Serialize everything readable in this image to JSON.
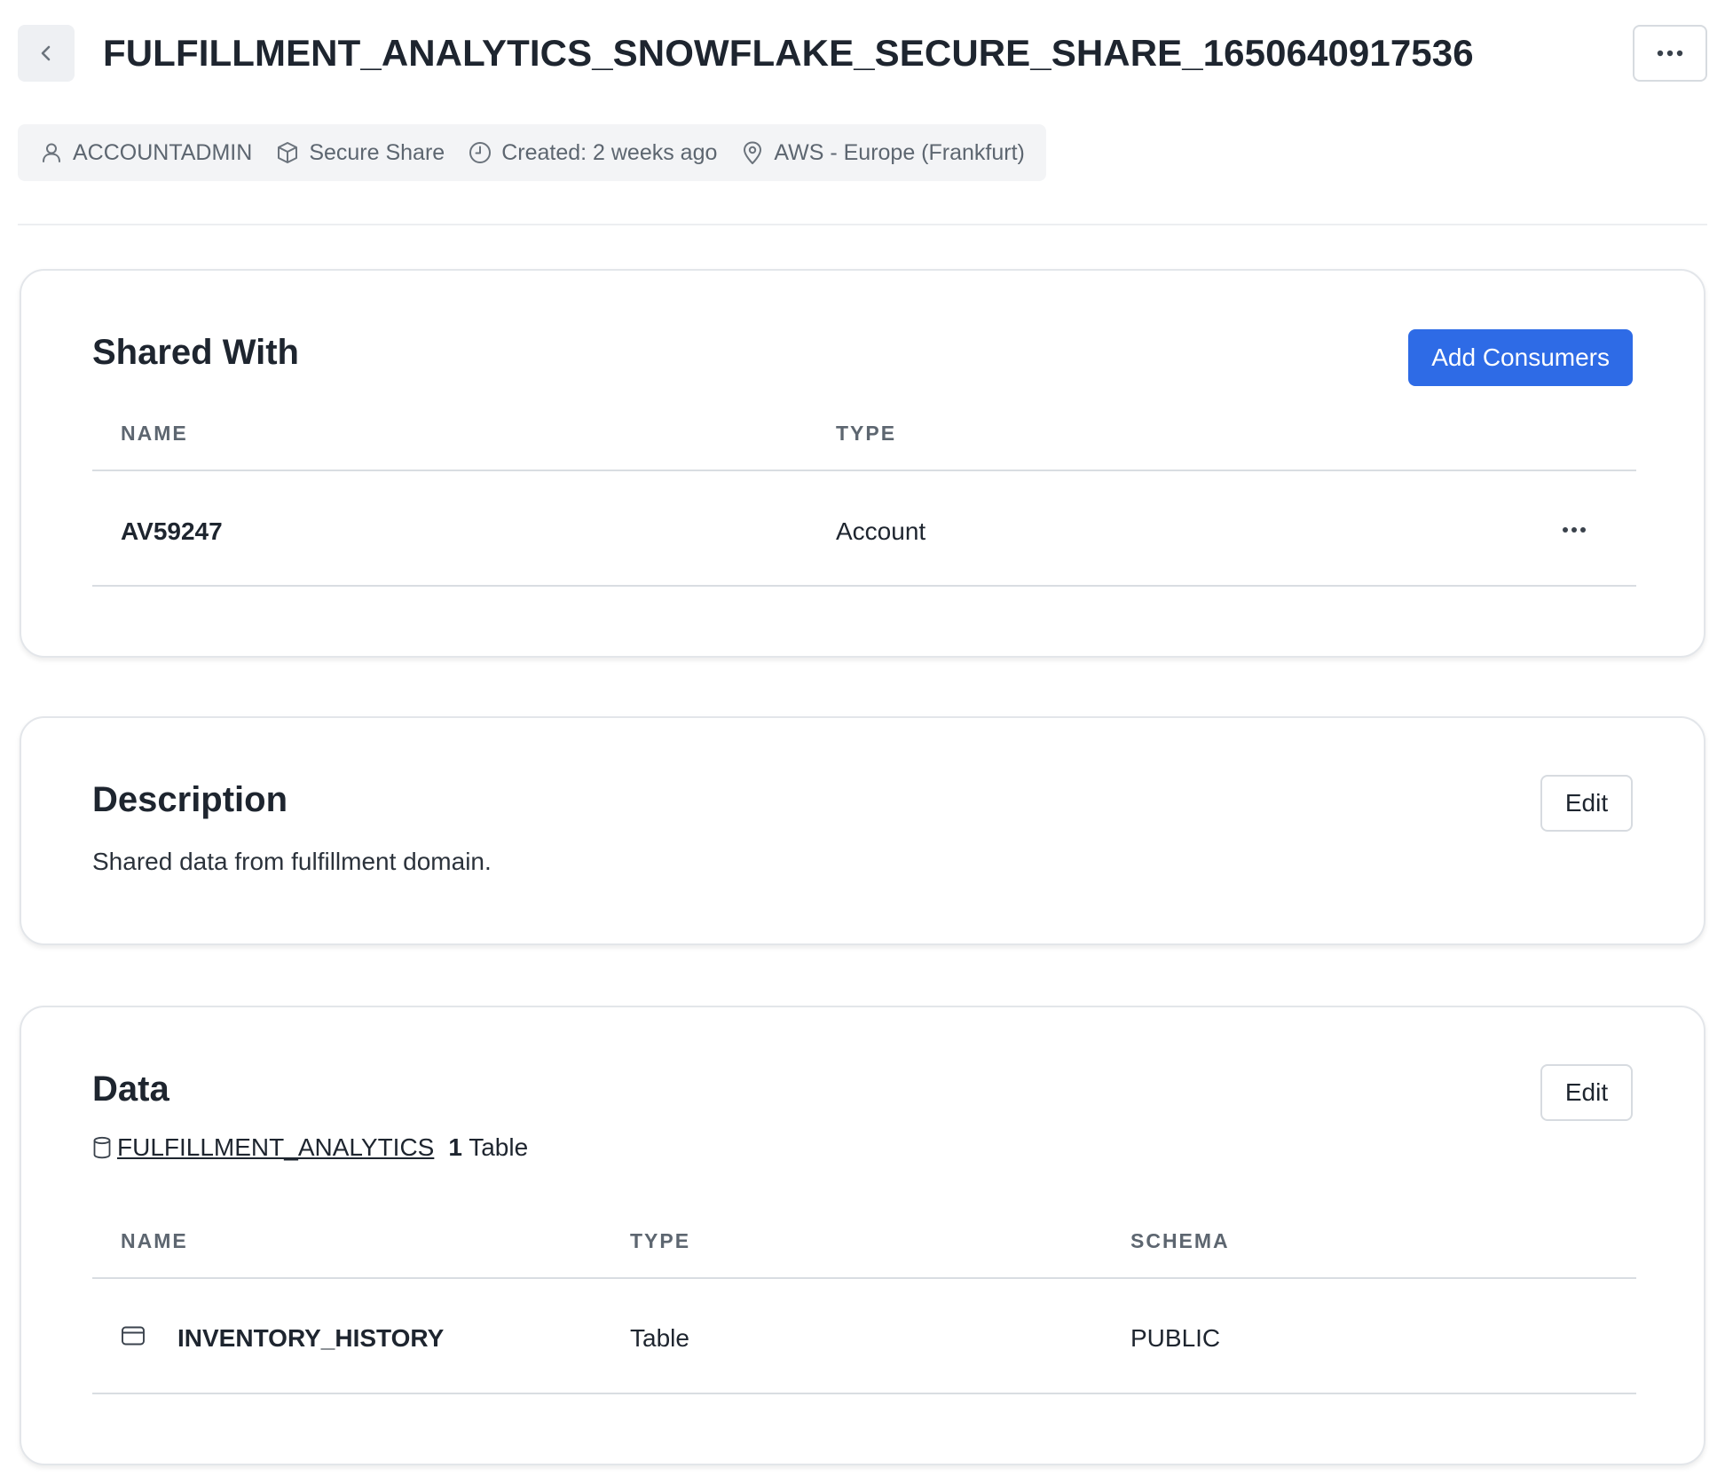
{
  "header": {
    "title": "FULFILLMENT_ANALYTICS_SNOWFLAKE_SECURE_SHARE_1650640917536",
    "back_icon": "chevron-left-icon",
    "more_icon": "ellipsis-icon"
  },
  "meta": {
    "role": "ACCOUNTADMIN",
    "kind": "Secure Share",
    "created": "Created: 2 weeks ago",
    "region": "AWS - Europe (Frankfurt)"
  },
  "shared_with": {
    "title": "Shared With",
    "add_button": "Add Consumers",
    "columns": {
      "name": "NAME",
      "type": "TYPE"
    },
    "rows": [
      {
        "name": "AV59247",
        "type": "Account"
      }
    ]
  },
  "description": {
    "title": "Description",
    "edit_button": "Edit",
    "text": "Shared data from fulfillment domain."
  },
  "data": {
    "title": "Data",
    "edit_button": "Edit",
    "database": "FULFILLMENT_ANALYTICS",
    "count": "1",
    "count_label": "Table",
    "columns": {
      "name": "NAME",
      "type": "TYPE",
      "schema": "SCHEMA"
    },
    "rows": [
      {
        "name": "INVENTORY_HISTORY",
        "type": "Table",
        "schema": "PUBLIC"
      }
    ]
  },
  "colors": {
    "accent": "#2e6be6",
    "text": "#1e252f",
    "muted": "#5d6670",
    "chip_bg": "#f3f4f6",
    "border": "#e3e6ea"
  }
}
